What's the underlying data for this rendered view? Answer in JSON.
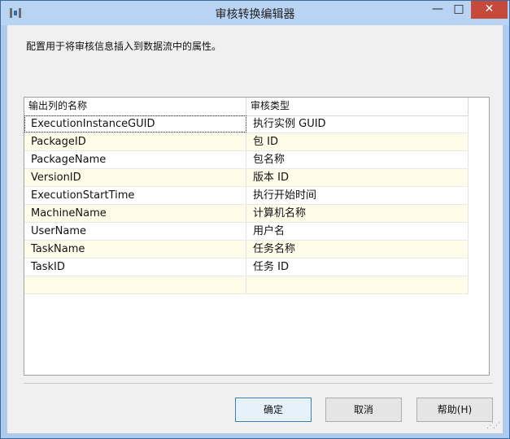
{
  "window": {
    "title": "审核转换编辑器",
    "minimize": "—",
    "maximize": "□",
    "close": "✕"
  },
  "description": "配置用于将审核信息插入到数据流中的属性。",
  "grid": {
    "headers": [
      "输出列的名称",
      "审核类型"
    ],
    "rows": [
      {
        "name": "ExecutionInstanceGUID",
        "type": "执行实例 GUID"
      },
      {
        "name": "PackageID",
        "type": "包 ID"
      },
      {
        "name": "PackageName",
        "type": "包名称"
      },
      {
        "name": "VersionID",
        "type": "版本 ID"
      },
      {
        "name": "ExecutionStartTime",
        "type": "执行开始时间"
      },
      {
        "name": "MachineName",
        "type": "计算机名称"
      },
      {
        "name": "UserName",
        "type": "用户名"
      },
      {
        "name": "TaskName",
        "type": "任务名称"
      },
      {
        "name": "TaskID",
        "type": "任务 ID"
      },
      {
        "name": "",
        "type": ""
      }
    ]
  },
  "buttons": {
    "ok": "确定",
    "cancel": "取消",
    "help": "帮助(H)"
  }
}
